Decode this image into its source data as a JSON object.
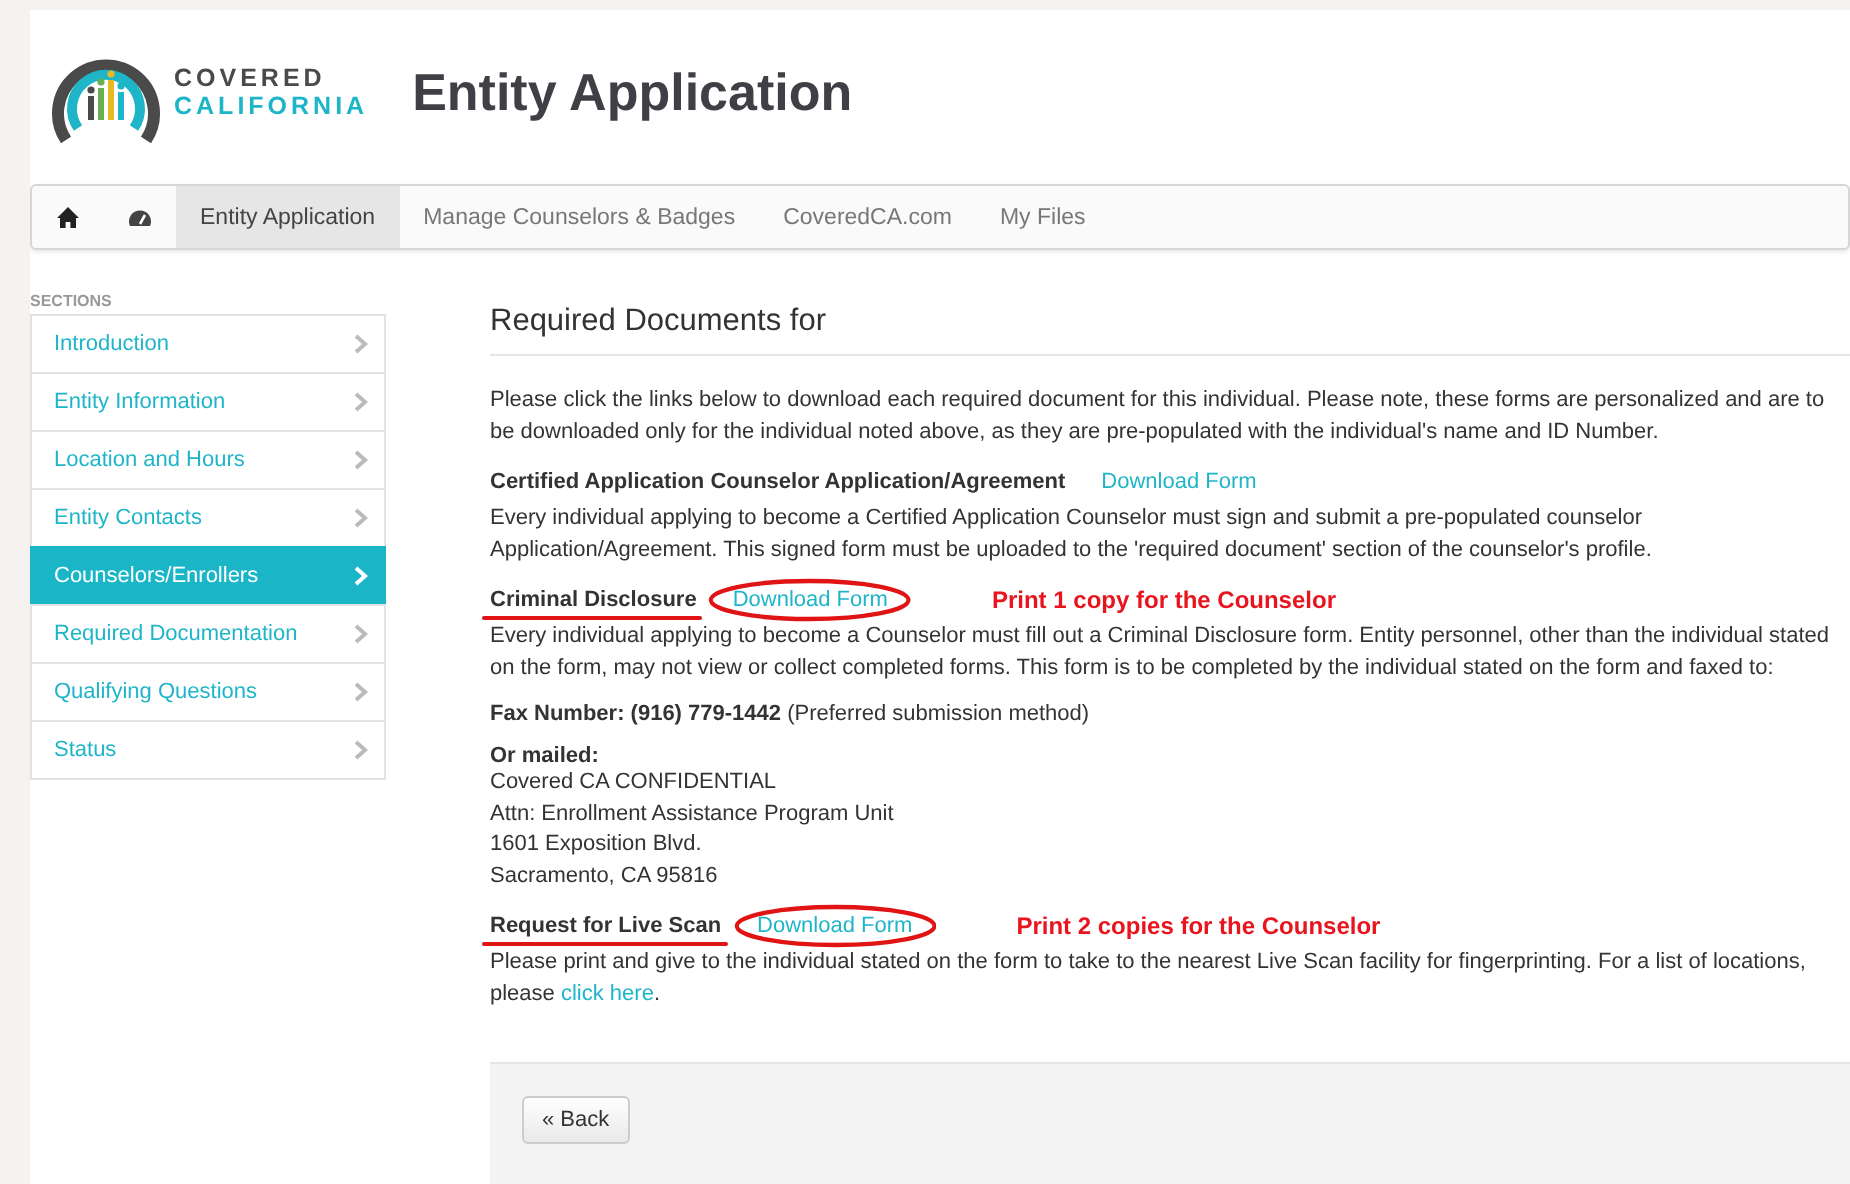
{
  "logo": {
    "line1": "COVERED",
    "line2": "CALIFORNIA"
  },
  "page_title": "Entity Application",
  "nav": {
    "tabs": [
      {
        "label": "Entity Application",
        "selected": true
      },
      {
        "label": "Manage Counselors & Badges",
        "selected": false
      },
      {
        "label": "CoveredCA.com",
        "selected": false
      },
      {
        "label": "My Files",
        "selected": false
      }
    ]
  },
  "sidebar": {
    "heading": "SECTIONS",
    "items": [
      {
        "label": "Introduction",
        "selected": false
      },
      {
        "label": "Entity Information",
        "selected": false
      },
      {
        "label": "Location and Hours",
        "selected": false
      },
      {
        "label": "Entity Contacts",
        "selected": false
      },
      {
        "label": "Counselors/Enrollers",
        "selected": true
      },
      {
        "label": "Required Documentation",
        "selected": false
      },
      {
        "label": "Qualifying Questions",
        "selected": false
      },
      {
        "label": "Status",
        "selected": false
      }
    ]
  },
  "main": {
    "heading": "Required Documents for",
    "intro": [
      "Please click the links below to download each required document for this individual. Please note, these forms are personalized and are to",
      "be downloaded only for the individual noted above, as they are pre-populated with the individual's name and ID Number."
    ],
    "documents": [
      {
        "title": "Certified Application Counselor Application/Agreement",
        "link": "Download Form",
        "underlined": false,
        "circled": false,
        "body": [
          "Every individual applying to become a Certified Application Counselor must sign and submit a pre-populated counselor",
          "Application/Agreement. This signed form must be uploaded to the 'required document' section of the counselor's profile."
        ]
      },
      {
        "title": "Criminal Disclosure",
        "link": "Download Form",
        "underlined": true,
        "circled": true,
        "note": "Print 1 copy for the Counselor",
        "body": [
          "Every individual applying to become a Counselor must fill out a Criminal Disclosure form. Entity personnel, other than the individual stated",
          "on the form, may not view or collect completed forms. This form is to be completed by the individual stated on the form and faxed to:"
        ],
        "fax": "**Fax Number: (916) 779-1442** (Preferred submission method)",
        "mail_label": "Or mailed:",
        "mail_address": [
          "Covered CA CONFIDENTIAL",
          "Attn: Enrollment Assistance Program Unit",
          "1601 Exposition Blvd.",
          "Sacramento, CA 95816"
        ]
      },
      {
        "title": "Request for Live Scan",
        "link": "Download Form",
        "underlined": true,
        "circled": true,
        "note": "Print 2 copies for the Counselor",
        "body": [
          "Please print and give to the individual stated on the form to take to the nearest Live Scan facility for fingerprinting. For a list of locations,",
          "please"
        ],
        "body_link": "click here",
        "body_suffix": "."
      }
    ]
  },
  "footer": {
    "back_button": "« Back"
  }
}
